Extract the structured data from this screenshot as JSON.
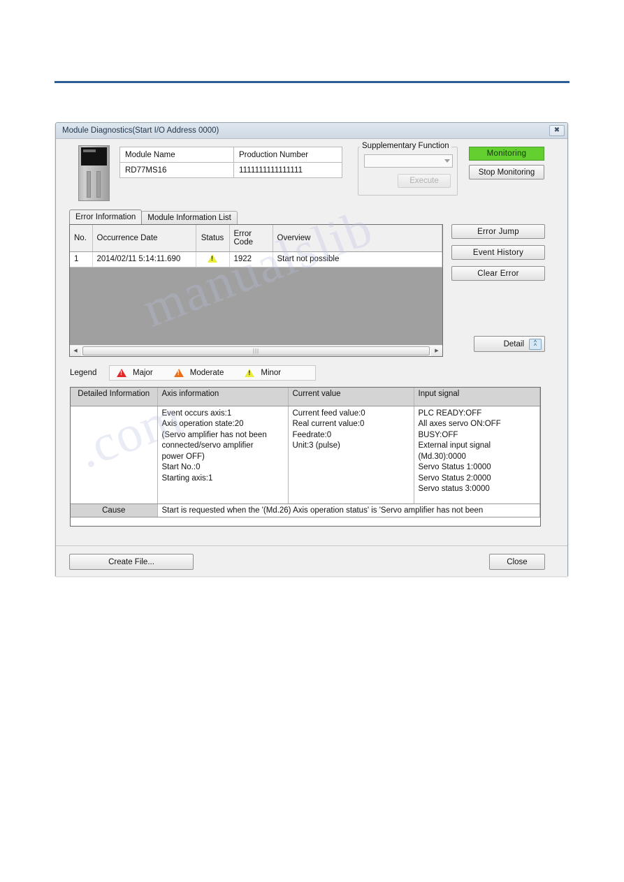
{
  "dialog": {
    "title": "Module Diagnostics(Start I/O Address 0000)",
    "close_icon": "close-x-icon"
  },
  "module_info": {
    "headers": [
      "Module Name",
      "Production Number"
    ],
    "module_name": "RD77MS16",
    "production_number": "1111111111111111"
  },
  "supplementary": {
    "legend": "Supplementary Function",
    "combo_value": "",
    "execute_label": "Execute"
  },
  "monitor": {
    "monitoring_label": "Monitoring",
    "stop_label": "Stop Monitoring",
    "monitoring_color": "#64d030"
  },
  "tabs": [
    {
      "label": "Error Information",
      "active": true
    },
    {
      "label": "Module Information List",
      "active": false
    }
  ],
  "error_table": {
    "headers": [
      "No.",
      "Occurrence Date",
      "Status",
      "Error Code",
      "Overview"
    ],
    "rows": [
      {
        "no": "1",
        "date": "2014/02/11 5:14:11.690",
        "status_icon": "warning-minor-icon",
        "code": "1922",
        "overview": "Start not possible"
      }
    ],
    "scroll_thumb_grip": "|||"
  },
  "side_buttons": {
    "error_jump": "Error Jump",
    "event_history": "Event History",
    "clear_error": "Clear Error",
    "detail": "Detail",
    "detail_chevron": "chevron-double-up-icon"
  },
  "legend": {
    "label": "Legend",
    "items": [
      {
        "label": "Major",
        "color": "#e02b28"
      },
      {
        "label": "Moderate",
        "color": "#e8701a"
      },
      {
        "label": "Minor",
        "color": "#e8ec3a"
      }
    ]
  },
  "detail_panel": {
    "corner_label": "Detailed Information",
    "headers": [
      "Axis information",
      "Current value",
      "Input signal"
    ],
    "axis_information": "Event occurs axis:1\nAxis operation state:20\n(Servo amplifier has not been\nconnected/servo amplifier\npower OFF)\nStart No.:0\nStarting axis:1",
    "current_value": "Current feed value:0\nReal current value:0\nFeedrate:0\nUnit:3 (pulse)",
    "input_signal": "PLC READY:OFF\nAll axes servo ON:OFF\nBUSY:OFF\nExternal input signal\n(Md.30):0000\nServo Status 1:0000\nServo Status 2:0000\nServo status 3:0000",
    "cause_label": "Cause",
    "cause_text": "Start is requested when the '(Md.26) Axis operation status' is 'Servo amplifier has not been"
  },
  "footer": {
    "create_file": "Create File...",
    "close": "Close"
  },
  "watermark": {
    "line1": "manualslib",
    "line2": ".com"
  }
}
